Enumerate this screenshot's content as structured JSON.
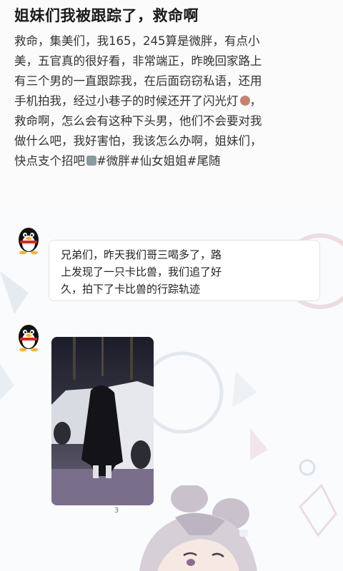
{
  "post": {
    "title": "姐妹们我被跟踪了，救命啊",
    "lines": [
      "救命，集美们，我165，245算是微胖，有点小",
      "美，五官真的很好看，非常端正，昨晚回家路上",
      "有三个男的一直跟踪我，在后面窃窃私语，还用",
      "手机拍我，经过小巷子的时候还开了闪光灯",
      "救命啊，怎么会有这种下头男，他们不会要对我",
      "做什么吧，我好害怕，我该怎么办啊，姐妹们，",
      "快点支个招吧"
    ],
    "tags": "#微胖#仙女姐姐#尾随",
    "emoji_1": "angry-face-emoji",
    "emoji_2": "phone-emoji"
  },
  "chat": {
    "message_1": {
      "avatar": "qq-penguin-icon",
      "lines": [
        "兄弟们，昨天我们哥三喝多了，路",
        "上发现了一只卡比兽，我们追了好",
        "久，拍下了卡比兽的行踪轨迹"
      ]
    },
    "message_2": {
      "avatar": "qq-penguin-icon",
      "photo_caption": "3"
    }
  },
  "colors": {
    "page_background": "#ffffff",
    "bubble_background": "#ffffff",
    "text": "#222222"
  }
}
